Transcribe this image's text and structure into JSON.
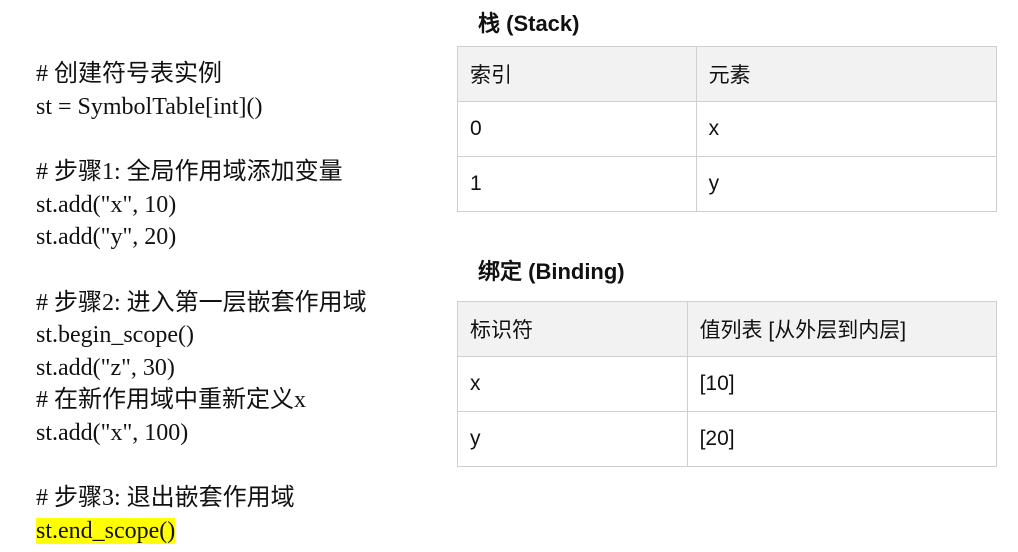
{
  "code": {
    "blocks": [
      [
        "# 创建符号表实例",
        "st = SymbolTable[int]()"
      ],
      [
        "# 步骤1: 全局作用域添加变量",
        "st.add(\"x\", 10)",
        "st.add(\"y\", 20)"
      ],
      [
        "# 步骤2: 进入第一层嵌套作用域",
        "st.begin_scope()",
        "st.add(\"z\", 30)",
        "# 在新作用域中重新定义x",
        "st.add(\"x\", 100)"
      ],
      [
        "# 步骤3: 退出嵌套作用域",
        "st.end_scope()"
      ]
    ],
    "highlighted_line": "st.end_scope()",
    "highlight_color": "#ffff00"
  },
  "stack": {
    "title": "栈 (Stack)",
    "headers": [
      "索引",
      "元素"
    ],
    "rows": [
      [
        "0",
        "x"
      ],
      [
        "1",
        "y"
      ]
    ]
  },
  "binding": {
    "title": "绑定 (Binding)",
    "headers": [
      "标识符",
      "值列表 [从外层到内层]"
    ],
    "rows": [
      [
        "x",
        "[10]"
      ],
      [
        "y",
        "[20]"
      ]
    ]
  },
  "colors": {
    "table_header_bg": "#f2f2f2",
    "table_border": "#cfcfcf"
  }
}
